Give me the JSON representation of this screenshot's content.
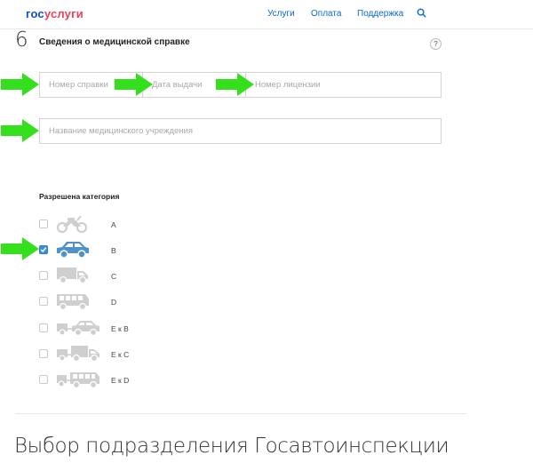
{
  "header": {
    "logo_part1": "гос",
    "logo_part2": "услуги",
    "nav": [
      "Услуги",
      "Оплата",
      "Поддержка"
    ]
  },
  "section": {
    "number": "6",
    "title": "Сведения о медицинской справке",
    "help": "?"
  },
  "fields": {
    "cert_number_placeholder": "Номер справки",
    "issue_date_placeholder": "Дата выдачи",
    "license_number_placeholder": "Номер лицензии",
    "institution_placeholder": "Название медицинского учреждения"
  },
  "categories": {
    "title": "Разрешена категория",
    "items": [
      {
        "label": "A",
        "icon": "motorcycle-icon",
        "checked": false
      },
      {
        "label": "B",
        "icon": "car-icon",
        "checked": true
      },
      {
        "label": "C",
        "icon": "truck-icon",
        "checked": false
      },
      {
        "label": "D",
        "icon": "bus-icon",
        "checked": false
      },
      {
        "label": "E к B",
        "icon": "car-trailer-icon",
        "checked": false
      },
      {
        "label": "E к C",
        "icon": "truck-trailer-icon",
        "checked": false
      },
      {
        "label": "E к D",
        "icon": "bus-trailer-icon",
        "checked": false
      }
    ]
  },
  "next_section_title": "Выбор подразделения Госавтоинспекции",
  "colors": {
    "accent": "#0a69c9",
    "checkbox_checked": "#3b8fd8",
    "arrow": "#33e01b",
    "vehicle_inactive": "#cfcfcf",
    "vehicle_active": "#4e92c9"
  }
}
